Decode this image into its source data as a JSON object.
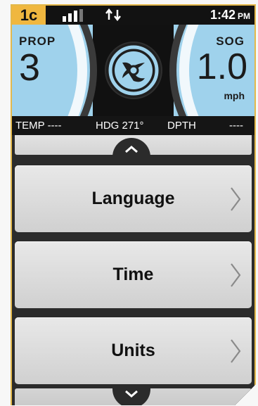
{
  "status": {
    "badge": "1c",
    "time": "1:42",
    "ampm": "PM",
    "signal_icon": "signal-bars-icon",
    "transfer_icon": "data-transfer-icon"
  },
  "gauges": {
    "left": {
      "label": "PROP",
      "value": "3"
    },
    "right": {
      "label": "SOG",
      "value": "1.0",
      "unit": "mph"
    },
    "center_icon": "propeller-icon"
  },
  "readout": {
    "temp": "TEMP ----",
    "heading": "HDG 271°",
    "depth_label": "DPTH",
    "depth_value": "----"
  },
  "menu": {
    "items": [
      {
        "label": "Language",
        "icon": "chevron-right-icon"
      },
      {
        "label": "Time",
        "icon": "chevron-right-icon"
      },
      {
        "label": "Units",
        "icon": "chevron-right-icon"
      }
    ],
    "scroll_up_icon": "chevron-up-icon",
    "scroll_down_icon": "chevron-down-icon"
  },
  "colors": {
    "badge": "#f0b73f",
    "gauge_bg": "#9fd2ec",
    "frame_border": "#e3b84a"
  }
}
